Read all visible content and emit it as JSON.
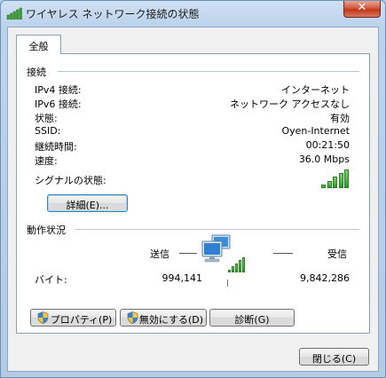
{
  "window": {
    "title": "ワイヤレス ネットワーク接続の状態",
    "close_glyph": "✕"
  },
  "tabs": [
    {
      "label": "全般"
    }
  ],
  "connection": {
    "title": "接続",
    "rows": [
      {
        "label": "IPv4 接続:",
        "value": "インターネット"
      },
      {
        "label": "IPv6 接続:",
        "value": "ネットワーク アクセスなし"
      },
      {
        "label": "状態:",
        "value": "有効"
      },
      {
        "label": "SSID:",
        "value": "Oyen-Internet"
      },
      {
        "label": "継続時間:",
        "value": "00:21:50"
      },
      {
        "label": "速度:",
        "value": "36.0 Mbps"
      }
    ],
    "signal_label": "シグナルの状態:",
    "signal_bars": 5,
    "details_button": "詳細(E)..."
  },
  "activity": {
    "title": "動作状況",
    "sent_label": "送信",
    "received_label": "受信",
    "bytes_label": "バイト:",
    "bytes_sent": "994,141",
    "bytes_received": "9,842,286",
    "icon": "network-computers-icon"
  },
  "buttons": {
    "properties": "プロパティ(P)",
    "disable": "無効にする(D)",
    "diagnose": "診断(G)",
    "close": "閉じる(C)"
  },
  "colors": {
    "signal_green": "#2e9a2a",
    "close_red": "#c3371a",
    "focus_blue": "#3c7fb1"
  }
}
